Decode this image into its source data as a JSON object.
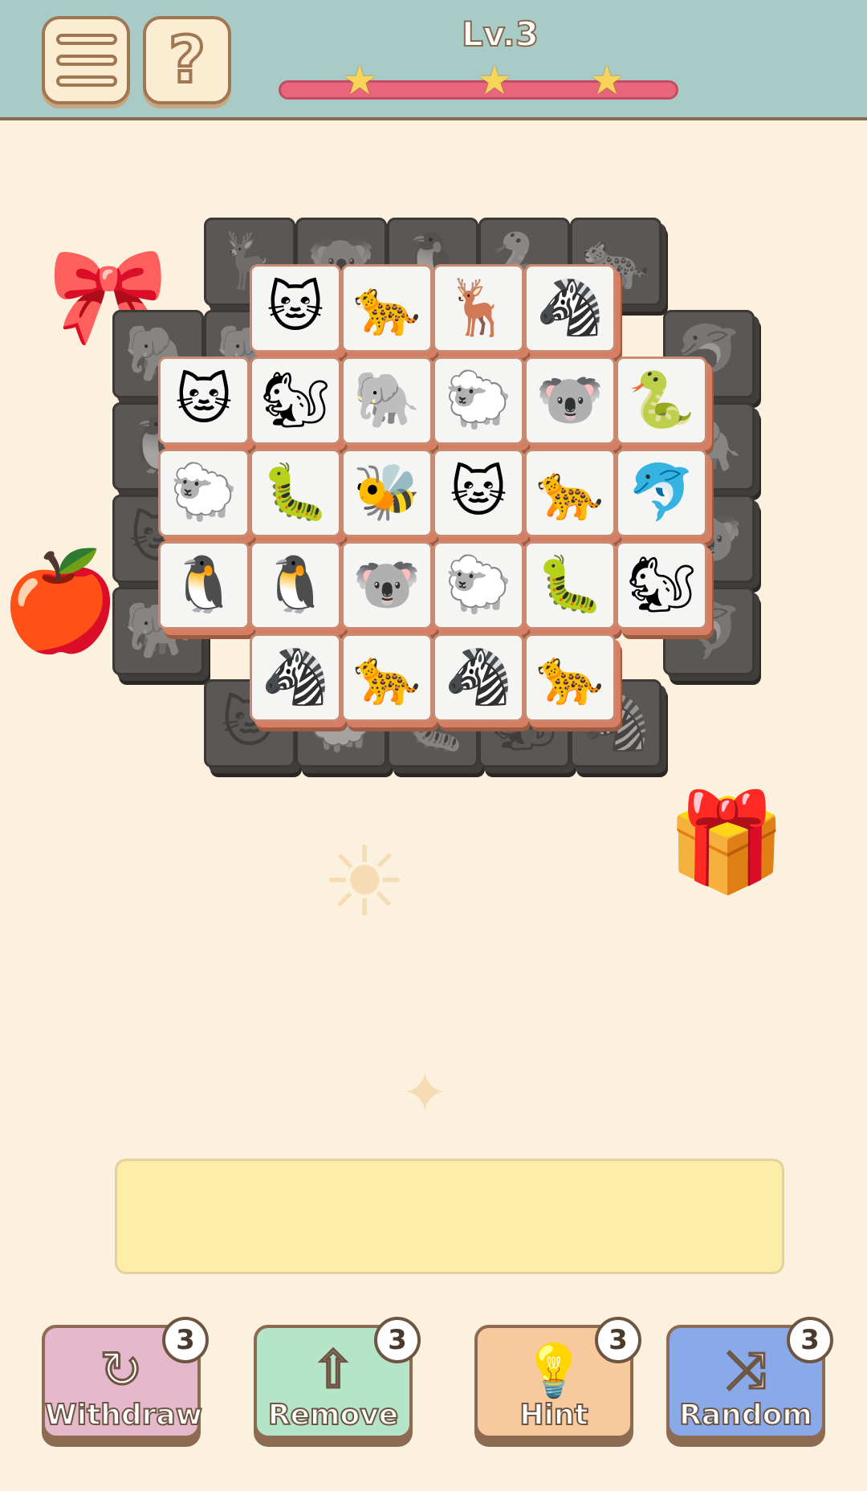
{
  "header": {
    "level_label": "Lv.3",
    "progress_stars": 3,
    "menu_icon": "list-icon",
    "help_icon": "question-icon",
    "help_glyph": "?"
  },
  "board": {
    "under_tiles": [
      {
        "animal": "deer",
        "glyph": "🦌"
      },
      {
        "animal": "koala",
        "glyph": "🐨"
      },
      {
        "animal": "penguin",
        "glyph": "🐧"
      },
      {
        "animal": "snake",
        "glyph": "🐍"
      },
      {
        "animal": "leopard",
        "glyph": "🐆"
      },
      {
        "animal": "elephant",
        "glyph": "🐘"
      },
      {
        "animal": "elephant",
        "glyph": "🐘"
      },
      {
        "animal": "dolphin",
        "glyph": "🐬"
      },
      {
        "animal": "penguin",
        "glyph": "🐧"
      },
      {
        "animal": "elephant",
        "glyph": "🐘"
      },
      {
        "animal": "cat",
        "glyph": "🐱"
      },
      {
        "animal": "koala",
        "glyph": "🐨"
      },
      {
        "animal": "elephant",
        "glyph": "🐘"
      },
      {
        "animal": "dolphin",
        "glyph": "🐬"
      },
      {
        "animal": "cat",
        "glyph": "🐱"
      },
      {
        "animal": "sheep",
        "glyph": "🐑"
      },
      {
        "animal": "caterpillar",
        "glyph": "🐛"
      },
      {
        "animal": "squirrel",
        "glyph": "🐿"
      },
      {
        "animal": "zebra",
        "glyph": "🦓"
      }
    ],
    "top_tiles": [
      {
        "animal": "cat",
        "glyph": "🐱"
      },
      {
        "animal": "leopard",
        "glyph": "🐆"
      },
      {
        "animal": "deer",
        "glyph": "🦌"
      },
      {
        "animal": "zebra",
        "glyph": "🦓"
      },
      {
        "animal": "cat",
        "glyph": "🐱"
      },
      {
        "animal": "squirrel",
        "glyph": "🐿"
      },
      {
        "animal": "elephant",
        "glyph": "🐘"
      },
      {
        "animal": "sheep",
        "glyph": "🐑"
      },
      {
        "animal": "koala",
        "glyph": "🐨"
      },
      {
        "animal": "snake",
        "glyph": "🐍"
      },
      {
        "animal": "sheep",
        "glyph": "🐑"
      },
      {
        "animal": "caterpillar",
        "glyph": "🐛"
      },
      {
        "animal": "bee",
        "glyph": "🐝"
      },
      {
        "animal": "cat",
        "glyph": "🐱"
      },
      {
        "animal": "leopard",
        "glyph": "🐆"
      },
      {
        "animal": "dolphin",
        "glyph": "🐬"
      },
      {
        "animal": "penguin",
        "glyph": "🐧"
      },
      {
        "animal": "penguin",
        "glyph": "🐧"
      },
      {
        "animal": "koala",
        "glyph": "🐨"
      },
      {
        "animal": "sheep",
        "glyph": "🐑"
      },
      {
        "animal": "caterpillar",
        "glyph": "🐛"
      },
      {
        "animal": "squirrel",
        "glyph": "🐿"
      },
      {
        "animal": "zebra",
        "glyph": "🦓"
      },
      {
        "animal": "leopard",
        "glyph": "🐆"
      },
      {
        "animal": "zebra",
        "glyph": "🦓"
      },
      {
        "animal": "leopard",
        "glyph": "🐆"
      }
    ]
  },
  "tray": {
    "slots_filled": 0
  },
  "tools": {
    "withdraw": {
      "label": "Withdraw",
      "count": "3",
      "icon": "undo-icon",
      "glyph": "↻"
    },
    "remove": {
      "label": "Remove",
      "count": "3",
      "icon": "remove-icon",
      "glyph": "⇧"
    },
    "hint": {
      "label": "Hint",
      "count": "3",
      "icon": "lightbulb-icon",
      "glyph": "💡"
    },
    "random": {
      "label": "Random",
      "count": "3",
      "icon": "shuffle-icon",
      "glyph": "⤨"
    }
  },
  "colors": {
    "header_bg": "#a9cbc8",
    "page_bg": "#fcf1df",
    "tray_bg": "#fdeda8",
    "progress": "#e8657c"
  }
}
